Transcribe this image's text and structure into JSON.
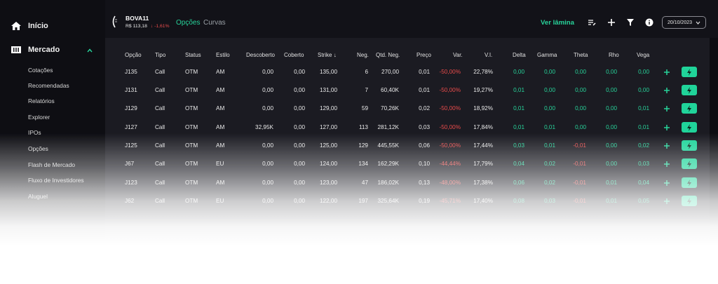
{
  "sidebar": {
    "home_label": "Início",
    "market_label": "Mercado",
    "items": [
      "Cotações",
      "Recomendadas",
      "Relatórios",
      "Explorer",
      "IPOs",
      "Opções",
      "Flash de Mercado",
      "Fluxo de Investidores",
      "Aluguel"
    ]
  },
  "header": {
    "ticker": "BOVA11",
    "price": "R$ 113,18",
    "change": "-1,61%",
    "tabs": [
      "Opções",
      "Curvas"
    ],
    "ver_lamina": "Ver lâmina",
    "date": "20/10/2023"
  },
  "table": {
    "columns": [
      "Opção",
      "Tipo",
      "Status",
      "Estilo",
      "Descoberto",
      "Coberto",
      "Strike",
      "Neg.",
      "Qtd. Neg.",
      "Preço",
      "Var.",
      "V.I.",
      "Delta",
      "Gamma",
      "Theta",
      "Rho",
      "Vega"
    ],
    "sort_indicator": "↓",
    "rows": [
      [
        "J135",
        "Call",
        "OTM",
        "AM",
        "0,00",
        "0,00",
        "135,00",
        "6",
        "270,00",
        "0,01",
        "-50,00%",
        "22,78%",
        "0,00",
        "0,00",
        "0,00",
        "0,00",
        "0,00"
      ],
      [
        "J131",
        "Call",
        "OTM",
        "AM",
        "0,00",
        "0,00",
        "131,00",
        "7",
        "60,40K",
        "0,01",
        "-50,00%",
        "19,27%",
        "0,01",
        "0,00",
        "0,00",
        "0,00",
        "0,00"
      ],
      [
        "J129",
        "Call",
        "OTM",
        "AM",
        "0,00",
        "0,00",
        "129,00",
        "59",
        "70,26K",
        "0,02",
        "-50,00%",
        "18,92%",
        "0,01",
        "0,00",
        "0,00",
        "0,00",
        "0,01"
      ],
      [
        "J127",
        "Call",
        "OTM",
        "AM",
        "32,95K",
        "0,00",
        "127,00",
        "113",
        "281,12K",
        "0,03",
        "-50,00%",
        "17,84%",
        "0,01",
        "0,01",
        "0,00",
        "0,00",
        "0,01"
      ],
      [
        "J125",
        "Call",
        "OTM",
        "AM",
        "0,00",
        "0,00",
        "125,00",
        "129",
        "445,55K",
        "0,06",
        "-50,00%",
        "17,44%",
        "0,03",
        "0,01",
        "-0,01",
        "0,00",
        "0,02"
      ],
      [
        "J67",
        "Call",
        "OTM",
        "EU",
        "0,00",
        "0,00",
        "124,00",
        "134",
        "162,29K",
        "0,10",
        "-44,44%",
        "17,79%",
        "0,04",
        "0,02",
        "-0,01",
        "0,00",
        "0,03"
      ],
      [
        "J123",
        "Call",
        "OTM",
        "AM",
        "0,00",
        "0,00",
        "123,00",
        "47",
        "186,02K",
        "0,13",
        "-48,00%",
        "17,38%",
        "0,06",
        "0,02",
        "-0,01",
        "0,01",
        "0,04"
      ],
      [
        "J62",
        "Call",
        "OTM",
        "EU",
        "0,00",
        "0,00",
        "122,00",
        "197",
        "325,64K",
        "0,19",
        "-45,71%",
        "17,40%",
        "0,08",
        "0,03",
        "-0,01",
        "0,01",
        "0,05"
      ]
    ]
  },
  "colors": {
    "accent": "#27d39a",
    "negative": "#e94b4b",
    "panel": "#1b1b22",
    "background": "#0d0d12"
  }
}
